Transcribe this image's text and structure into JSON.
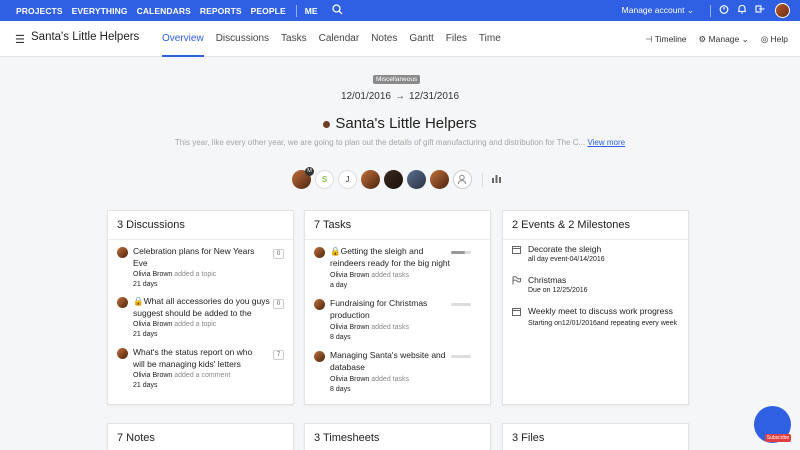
{
  "topnav": {
    "items": [
      "PROJECTS",
      "EVERYTHING",
      "CALENDARS",
      "REPORTS",
      "PEOPLE"
    ],
    "me": "ME",
    "manage_account": "Manage account ⌄"
  },
  "project": {
    "name": "Santa's Little Helpers",
    "tabs": [
      "Overview",
      "Discussions",
      "Tasks",
      "Calendar",
      "Notes",
      "Gantt",
      "Files",
      "Time"
    ],
    "right": {
      "timeline": "Timeline",
      "manage": "Manage",
      "help": "Help"
    }
  },
  "hero": {
    "category": "Miscellaneous",
    "start_date": "12/01/2016",
    "end_date": "12/31/2016",
    "title": "Santa's Little Helpers",
    "description": "This year, like every other year, we are going to plan out the details of gift manufacturing and distribution for The C...",
    "view_more": "View more",
    "members": [
      "M",
      "S",
      "J"
    ]
  },
  "discussions": {
    "header": "3 Discussions",
    "items": [
      {
        "title": "Celebration plans for New Years Eve",
        "author": "Olivia Brown",
        "action": "added a topic",
        "time": "21 days",
        "count": "0"
      },
      {
        "title": "What all accessories do you guys suggest should be added to the",
        "author": "Olivia Brown",
        "action": "added a topic",
        "time": "21 days",
        "count": "0"
      },
      {
        "title": "What's the status report on who will be managing kids' letters",
        "author": "Olivia Brown",
        "action": "added a comment",
        "time": "21 days",
        "count": "7"
      }
    ]
  },
  "tasks": {
    "header": "7 Tasks",
    "items": [
      {
        "title": "Getting the sleigh and reindeers ready for the big night",
        "author": "Olivia Brown",
        "action": "added tasks",
        "time": "a day",
        "progress": 0.7
      },
      {
        "title": "Fundraising for Christmas production",
        "author": "Olivia Brown",
        "action": "added tasks",
        "time": "8 days",
        "progress": 0
      },
      {
        "title": "Managing Santa's website and database",
        "author": "Olivia Brown",
        "action": "added tasks",
        "time": "8 days",
        "progress": 0
      }
    ]
  },
  "events": {
    "header": "2 Events & 2 Milestones",
    "items": [
      {
        "title": "Decorate the sleigh",
        "sub": "all day event-04/14/2016",
        "icon": "calendar-icon"
      },
      {
        "title": "Christmas",
        "sub": "Due on 12/25/2016",
        "icon": "flag-icon"
      },
      {
        "title": "Weekly meet to discuss work progress",
        "sub": "Starting on12/01/2016and repeating every week",
        "icon": "calendar-icon"
      }
    ]
  },
  "bottom": {
    "notes": "7 Notes",
    "timesheets": "3 Timesheets",
    "files": "3 Files"
  },
  "fab_badge": "Subscribe",
  "colors": {
    "brand": "#2f5fe3"
  }
}
